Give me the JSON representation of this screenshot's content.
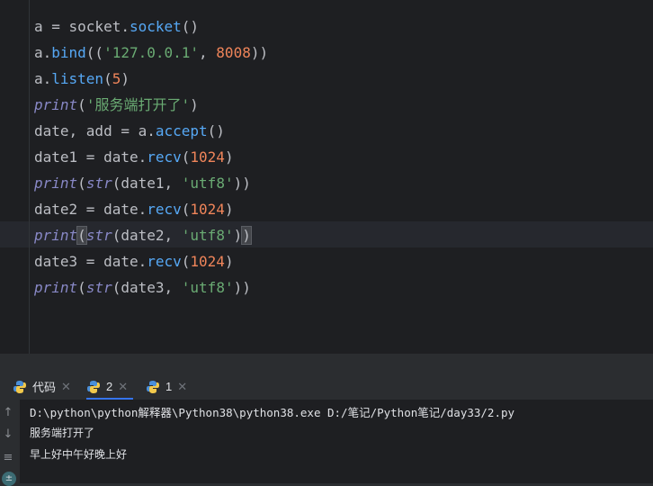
{
  "editor": {
    "lines": [
      [
        {
          "t": "a = socket.",
          "c": ""
        },
        {
          "t": "socket",
          "c": "fn"
        },
        {
          "t": "()",
          "c": ""
        }
      ],
      [
        {
          "t": "a.",
          "c": ""
        },
        {
          "t": "bind",
          "c": "fn"
        },
        {
          "t": "((",
          "c": ""
        },
        {
          "t": "'127.0.0.1'",
          "c": "str"
        },
        {
          "t": ", ",
          "c": ""
        },
        {
          "t": "8008",
          "c": "num2"
        },
        {
          "t": "))",
          "c": ""
        }
      ],
      [
        {
          "t": "a.",
          "c": ""
        },
        {
          "t": "listen",
          "c": "fn"
        },
        {
          "t": "(",
          "c": ""
        },
        {
          "t": "5",
          "c": "num2"
        },
        {
          "t": ")",
          "c": ""
        }
      ],
      [
        {
          "t": "print",
          "c": "kw"
        },
        {
          "t": "(",
          "c": ""
        },
        {
          "t": "'服务端打开了'",
          "c": "str"
        },
        {
          "t": ")",
          "c": ""
        }
      ],
      [
        {
          "t": "date, add = a.",
          "c": ""
        },
        {
          "t": "accept",
          "c": "fn"
        },
        {
          "t": "()",
          "c": ""
        }
      ],
      [
        {
          "t": "date1 = date.",
          "c": ""
        },
        {
          "t": "recv",
          "c": "fn"
        },
        {
          "t": "(",
          "c": ""
        },
        {
          "t": "1024",
          "c": "num2"
        },
        {
          "t": ")",
          "c": ""
        }
      ],
      [
        {
          "t": "print",
          "c": "kw"
        },
        {
          "t": "(",
          "c": ""
        },
        {
          "t": "str",
          "c": "kw"
        },
        {
          "t": "(date1, ",
          "c": ""
        },
        {
          "t": "'utf8'",
          "c": "str"
        },
        {
          "t": "))",
          "c": ""
        }
      ],
      [
        {
          "t": "date2 = date.",
          "c": ""
        },
        {
          "t": "recv",
          "c": "fn"
        },
        {
          "t": "(",
          "c": ""
        },
        {
          "t": "1024",
          "c": "num2"
        },
        {
          "t": ")",
          "c": ""
        }
      ],
      [
        {
          "t": "print",
          "c": "kw"
        },
        {
          "t": "(",
          "c": "hl"
        },
        {
          "t": "str",
          "c": "kw"
        },
        {
          "t": "(date2, ",
          "c": ""
        },
        {
          "t": "'utf8'",
          "c": "str"
        },
        {
          "t": ")",
          "c": ""
        },
        {
          "t": ")",
          "c": "hl"
        }
      ],
      [
        {
          "t": "date3 = date.",
          "c": ""
        },
        {
          "t": "recv",
          "c": "fn"
        },
        {
          "t": "(",
          "c": ""
        },
        {
          "t": "1024",
          "c": "num2"
        },
        {
          "t": ")",
          "c": ""
        }
      ],
      [
        {
          "t": "print",
          "c": "kw"
        },
        {
          "t": "(",
          "c": ""
        },
        {
          "t": "str",
          "c": "kw"
        },
        {
          "t": "(date3, ",
          "c": ""
        },
        {
          "t": "'utf8'",
          "c": "str"
        },
        {
          "t": "))",
          "c": ""
        }
      ]
    ]
  },
  "tabs": [
    {
      "label": "代码",
      "active": false
    },
    {
      "label": "2",
      "active": true
    },
    {
      "label": "1",
      "active": false
    }
  ],
  "console": {
    "command": "D:\\python\\python解释器\\Python38\\python38.exe D:/笔记/Python笔记/day33/2.py",
    "output": [
      "服务端打开了",
      "早上好中午好晚上好"
    ]
  },
  "colors": {
    "editor_bg": "#1e1f22",
    "function": "#56a8f5",
    "string": "#6aab73",
    "number": "#f0855a",
    "builtin": "#8888c6",
    "tab_underline": "#3574f0"
  }
}
